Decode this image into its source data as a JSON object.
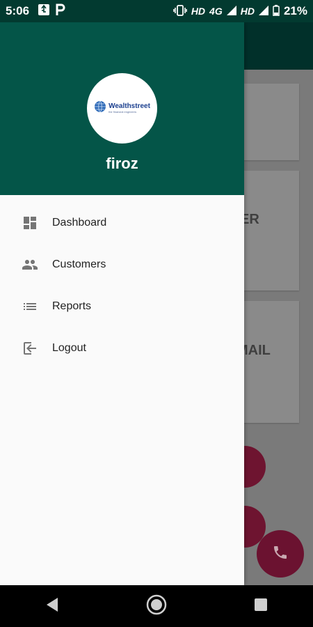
{
  "status_bar": {
    "time": "5:06",
    "network_left": "HD",
    "network_type": "4G",
    "network_right": "HD",
    "battery_percent": "21%"
  },
  "background": {
    "card_texts": [
      "ER",
      "MAIL"
    ],
    "accent_color": "#045548",
    "fab_color": "#6b1230"
  },
  "drawer": {
    "avatar_logo": {
      "title": "Wealthstreet",
      "subtitle": "the financial engineers"
    },
    "username": "firoz",
    "items": [
      {
        "label": "Dashboard",
        "icon": "dashboard-icon"
      },
      {
        "label": "Customers",
        "icon": "people-icon"
      },
      {
        "label": "Reports",
        "icon": "list-icon"
      },
      {
        "label": "Logout",
        "icon": "logout-icon"
      }
    ]
  },
  "nav_bar": {
    "buttons": [
      "back-icon",
      "home-icon",
      "recents-icon"
    ]
  }
}
